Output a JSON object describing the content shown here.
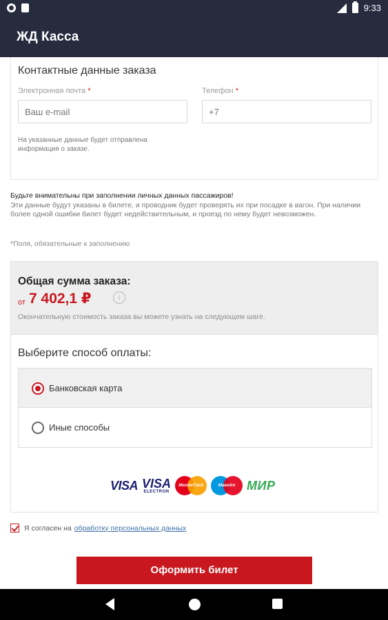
{
  "status_bar": {
    "time": "9:33"
  },
  "app_bar": {
    "title": "ЖД Касса"
  },
  "contact": {
    "title": "Контактные данные заказа",
    "email_label": "Электронная почта",
    "email_placeholder": "Ваш e-mail",
    "phone_label": "Телефон",
    "phone_value": "+7",
    "required_mark": "*",
    "note": "На указанные данные будет отправлена информация о заказе."
  },
  "warning": {
    "strong": "Будьте внимательны при заполнении личных данных пассажиров!",
    "text": "Эти данные будут указаны в билете, и проводник будет проверять их при посадке в вагон. При наличии более одной ошибки билет будет недействительным, и проезд по нему будет невозможен."
  },
  "required_note": "*Поля, обязательные к заполнению",
  "total": {
    "title": "Общая сумма заказа:",
    "from": "от",
    "amount": "7 402,1 ₽",
    "info_icon": "i",
    "note": "Окончательную стоимость заказа вы можете узнать на следующем шаге."
  },
  "payment": {
    "title": "Выберите способ оплаты:",
    "options": [
      {
        "label": "Банковская карта",
        "selected": true
      },
      {
        "label": "Иные способы",
        "selected": false
      }
    ],
    "logos": {
      "visa": "VISA",
      "visa_electron_top": "VISA",
      "visa_electron_bottom": "ELECTRON",
      "mastercard": "MasterCard",
      "maestro": "Maestro",
      "mir": "МИР"
    }
  },
  "agreement": {
    "text": "Я согласен на",
    "link": "обработку персональных данных",
    "checked": true
  },
  "submit_button": "Оформить билет",
  "colors": {
    "header": "#262b3e",
    "accent": "#c8171e",
    "link": "#3c6fa8"
  }
}
